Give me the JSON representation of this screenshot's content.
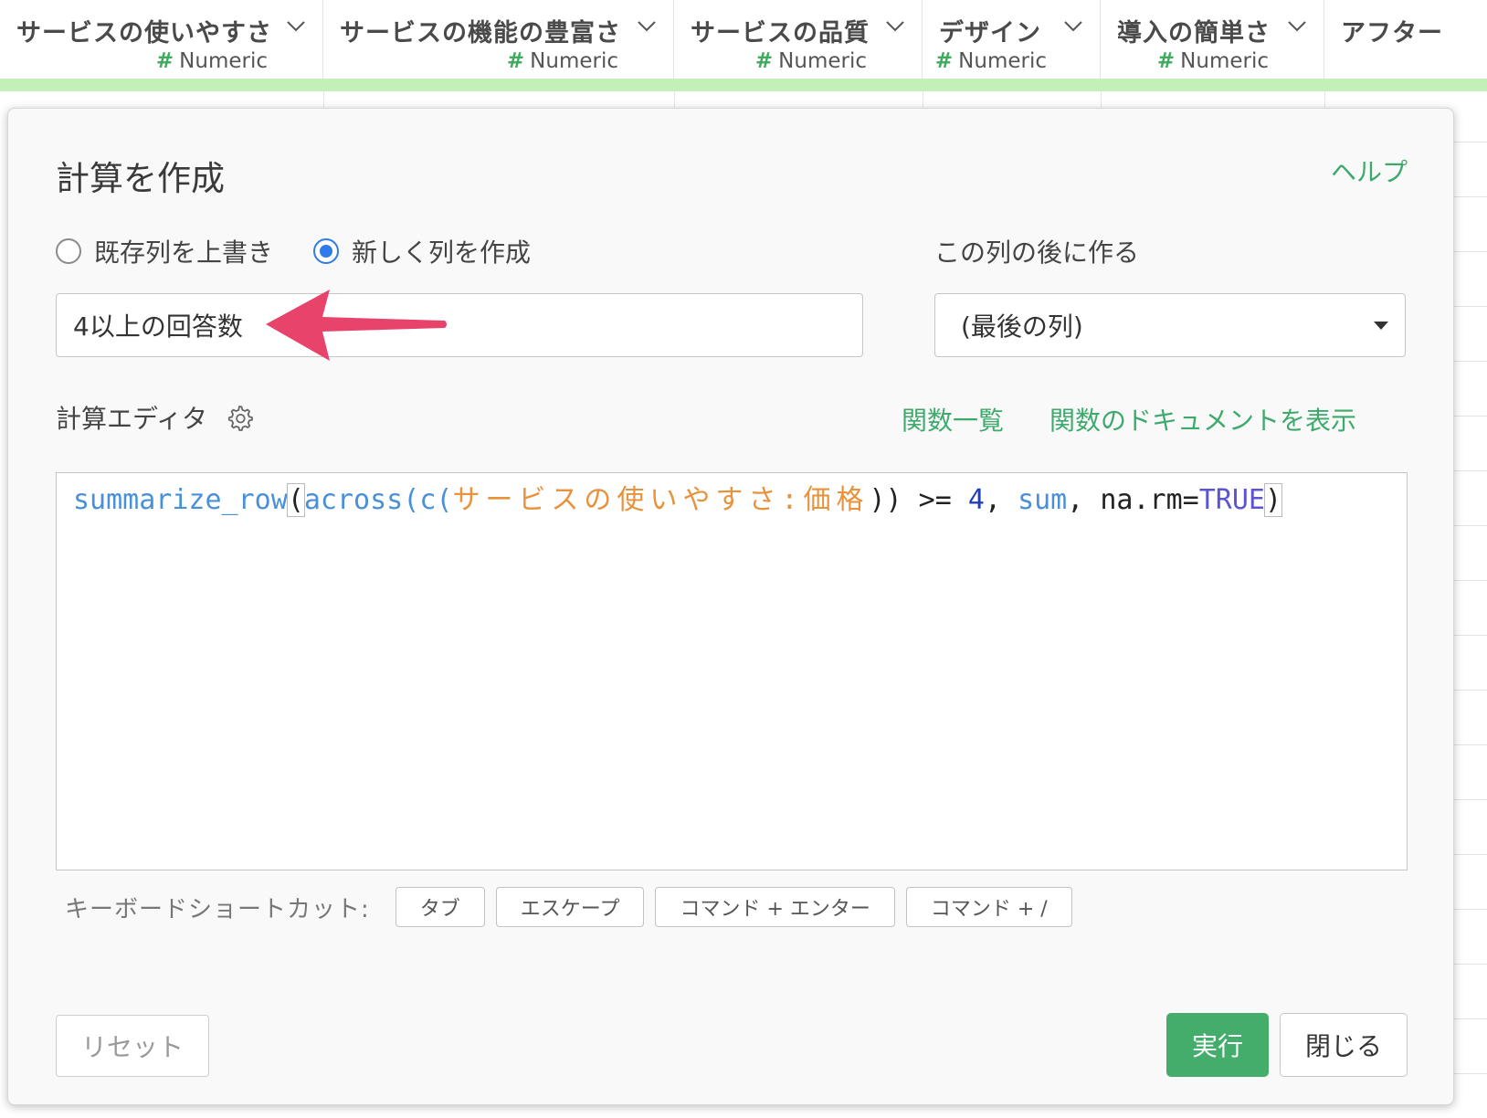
{
  "columns": [
    {
      "name": "サービスの使いやすさ",
      "type": "Numeric"
    },
    {
      "name": "サービスの機能の豊富さ",
      "type": "Numeric"
    },
    {
      "name": "サービスの品質",
      "type": "Numeric"
    },
    {
      "name": "デザイン",
      "type": "Numeric"
    },
    {
      "name": "導入の簡単さ",
      "type": "Numeric"
    },
    {
      "name": "アフター",
      "type": ""
    }
  ],
  "type_hash": "#",
  "dialog": {
    "title": "計算を作成",
    "help_label": "ヘルプ",
    "radio_overwrite": "既存列を上書き",
    "radio_new": "新しく列を作成",
    "after_label": "この列の後に作る",
    "column_name_value": "4以上の回答数",
    "after_select_value": "(最後の列)",
    "editor_label": "計算エディタ",
    "func_list_label": "関数一覧",
    "func_doc_label": "関数のドキュメントを表示",
    "code": {
      "fn1": "summarize_row",
      "p1": "(",
      "fn2": "across",
      "p2": "(",
      "fn3": "c",
      "p3": "(",
      "col_range": "サービスの使いやすさ:価格",
      "p4": "))",
      "op": " >= ",
      "num": "4",
      "comma1": ", ",
      "fn4": "sum",
      "comma2": ", ",
      "arg": "na.rm=",
      "kw": "TRUE",
      "p5": ")"
    },
    "shortcut_label": "キーボードショートカット:",
    "shortcuts": [
      "タブ",
      "エスケープ",
      "コマンド + エンター",
      "コマンド + /"
    ],
    "reset_label": "リセット",
    "run_label": "実行",
    "close_label": "閉じる"
  },
  "colors": {
    "accent_green": "#45ad6c",
    "link_green": "#3daa6c",
    "radio_blue": "#2f7bea",
    "annotation_arrow": "#e8436b"
  }
}
